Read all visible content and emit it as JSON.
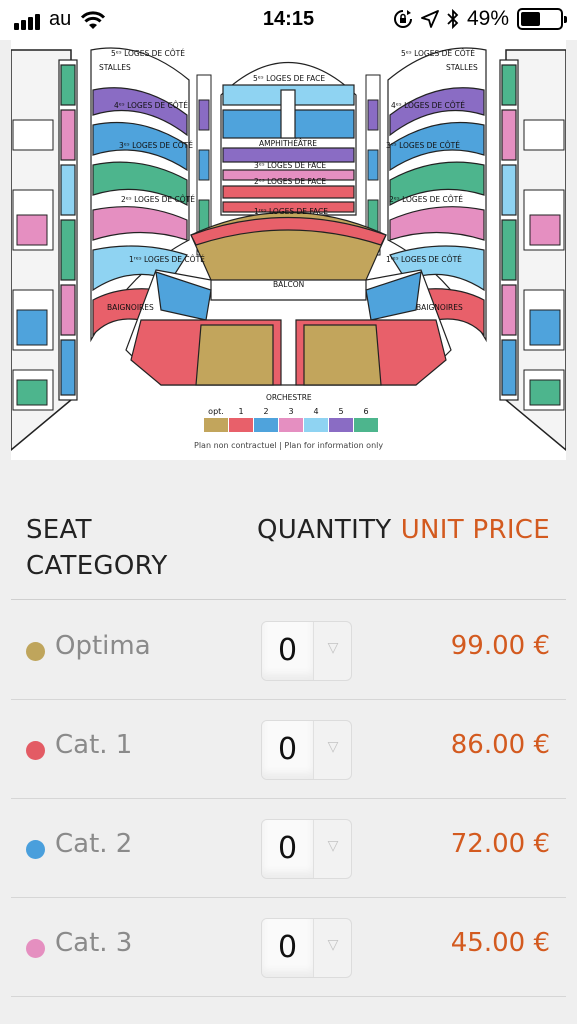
{
  "status_bar": {
    "carrier": "au",
    "time": "14:15",
    "battery": "49%",
    "battery_level": 0.49
  },
  "seat_map": {
    "labels": {
      "loges_cote_5": "5ᵉˢ LOGES DE CÔTÉ",
      "stalles": "STALLES",
      "loges_cote_4": "4ᵉˢ LOGES DE CÔTÉ",
      "loges_cote_3": "3ᵉˢ LOGES DE CÔTÉ",
      "loges_cote_2": "2ᵉˢ LOGES DE CÔTÉ",
      "loges_cote_1": "1ʳᵉˢ LOGES DE CÔTÉ",
      "baignoires": "BAIGNOIRES",
      "loges_face_5": "5ᵉˢ LOGES DE FACE",
      "amphitheatre": "AMPHITHÉÂTRE",
      "loges_face_3": "3ᵉˢ LOGES DE FACE",
      "loges_face_2": "2ᵉˢ LOGES DE FACE",
      "loges_face_1": "1ʳᵉˢ LOGES DE FACE",
      "balcon": "BALCON",
      "orchestre": "ORCHESTRE",
      "disclaimer": "Plan non contractuel | Plan for information only"
    },
    "legend": [
      {
        "label": "opt.",
        "color": "#c2a55c"
      },
      {
        "label": "1",
        "color": "#e8606a"
      },
      {
        "label": "2",
        "color": "#4fa3dc"
      },
      {
        "label": "3",
        "color": "#e58fc1"
      },
      {
        "label": "4",
        "color": "#8fd3f2"
      },
      {
        "label": "5",
        "color": "#8a6cc4"
      },
      {
        "label": "6",
        "color": "#4db58d"
      }
    ]
  },
  "table": {
    "header": {
      "category": "SEAT CATEGORY",
      "quantity": "QUANTITY",
      "price": "UNIT PRICE"
    },
    "rows": [
      {
        "name": "Optima",
        "color": "#bfa55c",
        "quantity": "0",
        "price": "99.00 €"
      },
      {
        "name": "Cat. 1",
        "color": "#e35b64",
        "quantity": "0",
        "price": "86.00 €"
      },
      {
        "name": "Cat. 2",
        "color": "#4a9fdc",
        "quantity": "0",
        "price": "72.00 €"
      },
      {
        "name": "Cat. 3",
        "color": "#e58fc0",
        "quantity": "0",
        "price": "45.00 €"
      }
    ]
  },
  "icons": [
    "signal-bars-icon",
    "wifi-icon",
    "rotation-lock-icon",
    "location-arrow-icon",
    "bluetooth-icon",
    "battery-icon",
    "chevron-down-icon"
  ]
}
